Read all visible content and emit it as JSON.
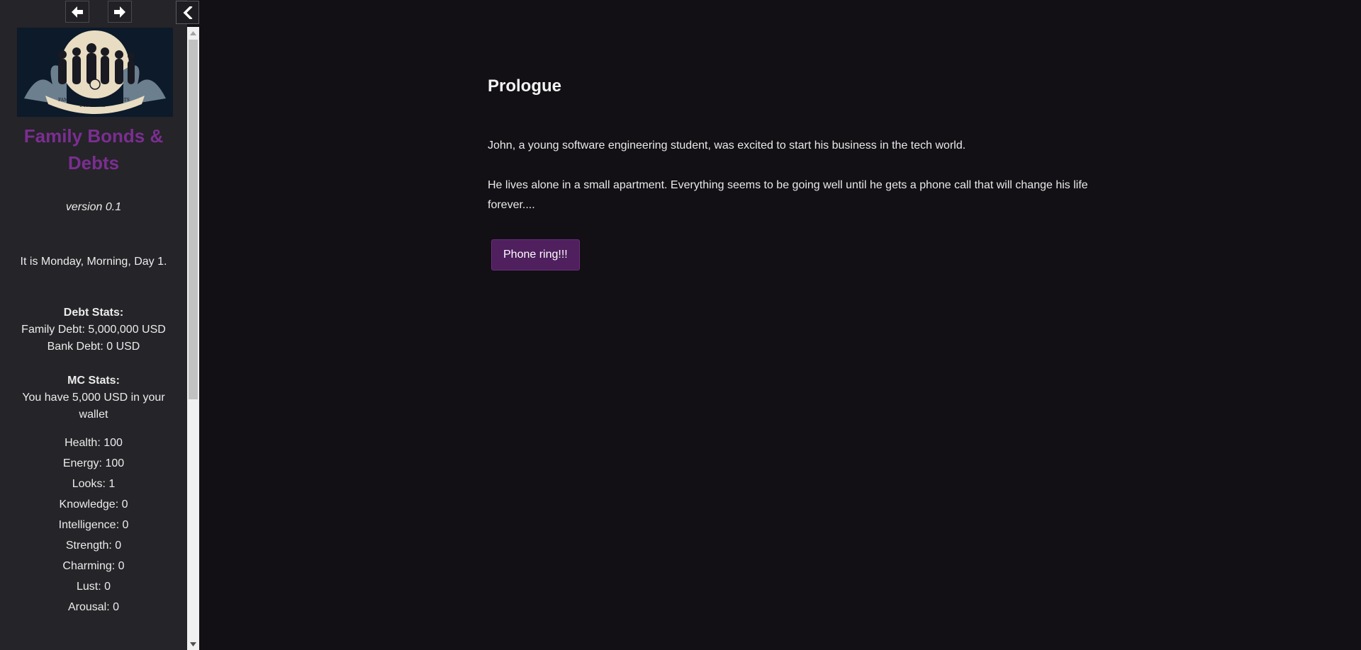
{
  "sidebar": {
    "story_title": "Family Bonds & Debts",
    "version": "version 0.1",
    "time_text": "It is Monday, Morning, Day 1.",
    "debt_header": "Debt Stats:",
    "family_debt": "Family Debt: 5,000,000 USD",
    "bank_debt": "Bank Debt: 0 USD",
    "mc_header": "MC Stats:",
    "wallet": "You have 5,000 USD in your wallet",
    "stats": [
      "Health: 100",
      "Energy: 100",
      "Looks: 1",
      "Knowledge: 0",
      "Intelligence: 0",
      "Strength: 0",
      "Charming: 0",
      "Lust: 0",
      "Arousal: 0"
    ],
    "logo_text": [
      "FAMILY",
      "BONDS",
      "&",
      "DEBTS"
    ]
  },
  "icons": {
    "back": "arrow-left-icon",
    "forward": "arrow-right-icon",
    "toggle": "chevron-left-icon"
  },
  "passage": {
    "title": "Prologue",
    "paragraphs": [
      "John, a young software engineering student, was excited to start his business in the tech world.",
      "He lives alone in a small apartment. Everything seems to be going well until he gets a phone call that will change his life forever...."
    ],
    "link_label": "Phone ring!!!"
  },
  "colors": {
    "accent": "#7b2e92",
    "button": "#4f1f5e",
    "background": "#121014",
    "sidebar": "#252428"
  }
}
